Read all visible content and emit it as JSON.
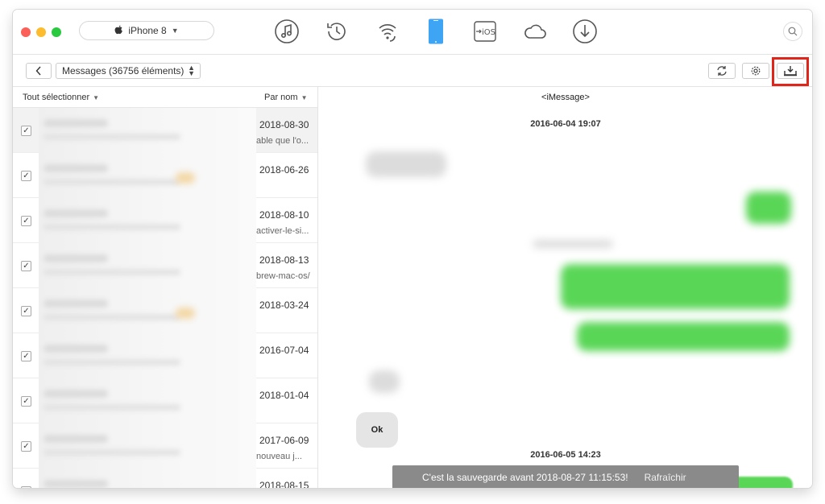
{
  "titlebar": {
    "device_name": "iPhone 8",
    "device_icon": "apple-icon",
    "tools": [
      {
        "name": "music-icon"
      },
      {
        "name": "history-icon"
      },
      {
        "name": "wifi-icon"
      },
      {
        "name": "iphone-device-icon"
      },
      {
        "name": "ios-transfer-icon",
        "label": "iOS"
      },
      {
        "name": "cloud-icon"
      },
      {
        "name": "download-icon"
      }
    ]
  },
  "toolbar": {
    "category": "Messages (36756 éléments)"
  },
  "list": {
    "select_all": "Tout sélectionner",
    "sort_by": "Par nom",
    "rows": [
      {
        "date": "2018-08-30",
        "snippet": "able que l'o...",
        "checked": true
      },
      {
        "date": "2018-06-26",
        "snippet": "",
        "checked": true
      },
      {
        "date": "2018-08-10",
        "snippet": "activer-le-si...",
        "checked": true
      },
      {
        "date": "2018-08-13",
        "snippet": "brew-mac-os/",
        "checked": true
      },
      {
        "date": "2018-03-24",
        "snippet": "",
        "checked": true
      },
      {
        "date": "2016-07-04",
        "snippet": "",
        "checked": true
      },
      {
        "date": "2018-01-04",
        "snippet": "",
        "checked": true
      },
      {
        "date": "2017-06-09",
        "snippet": "nouveau j...",
        "checked": true
      },
      {
        "date": "2018-08-15",
        "snippet": "",
        "checked": true
      }
    ]
  },
  "conversation": {
    "title": "<iMessage>",
    "date1": "2016-06-04 19:07",
    "ok_text": "Ok",
    "date2": "2016-06-05 14:23"
  },
  "toast": {
    "message": "C'est la sauvegarde avant 2018-08-27 11:15:53!",
    "action": "Rafraîchir"
  },
  "colors": {
    "highlight": "#e0261a",
    "bubble_green": "#5ad657",
    "device_blue": "#3ea5f5"
  }
}
